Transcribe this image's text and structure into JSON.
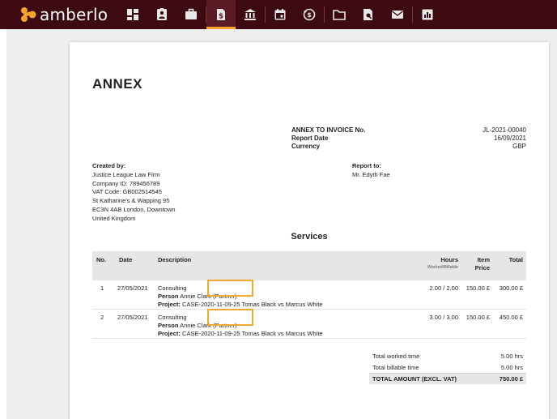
{
  "app": {
    "brand": "amberlo"
  },
  "nav": {
    "items": [
      {
        "name": "dashboard-icon"
      },
      {
        "name": "contacts-icon"
      },
      {
        "name": "briefcase-icon"
      },
      {
        "name": "invoice-icon"
      },
      {
        "name": "bank-icon"
      },
      {
        "name": "calendar-icon"
      },
      {
        "name": "time-money-icon"
      },
      {
        "name": "folder-icon"
      },
      {
        "name": "document-search-icon"
      },
      {
        "name": "mail-icon"
      },
      {
        "name": "reports-icon"
      }
    ],
    "active_index": 3,
    "accent": "#f7a42a",
    "bar_color": "#3d0a12"
  },
  "document": {
    "title": "ANNEX",
    "meta": [
      {
        "label": "ANNEX TO INVOICE No.",
        "value": "JL-2021-00040"
      },
      {
        "label": "Report Date",
        "value": "16/09/2021"
      },
      {
        "label": "Currency",
        "value": "GBP"
      }
    ],
    "created_by": {
      "label": "Created by:",
      "lines": [
        "Justice League Law Firm",
        "Company ID: 789456789",
        "VAT Code: GB002514545",
        "St Katharine's & Wapping 95",
        "EC3N 4AB London, Downtown",
        "United Kingdom"
      ]
    },
    "report_to": {
      "label": "Report to:",
      "name": "Mr. Edyth Fae"
    },
    "services_title": "Services",
    "table": {
      "headers": {
        "no": "No.",
        "date": "Date",
        "description": "Description",
        "hours": "Hours",
        "hours_sub": "Worked/Billable",
        "item_price_1": "Item",
        "item_price_2": "Price",
        "total": "Total"
      },
      "rows": [
        {
          "no": "1",
          "date": "27/05/2021",
          "desc": "Consulting",
          "person_label": "Person",
          "person": "Annie Clark (Partner)",
          "project_label": "Project:",
          "project": "CASE-2020-11-09-25 Tomas Black vs Marcus White",
          "hours": "2.00 /  2.00",
          "price": "150.00 £",
          "total": "300.00 £"
        },
        {
          "no": "2",
          "date": "27/05/2021",
          "desc": "Consulting",
          "person_label": "Person",
          "person": "Annie Clark (Partner)",
          "project_label": "Project:",
          "project": "CASE-2020-11-09-25 Tomas Black vs Marcus White",
          "hours": "3.00 /  3.00",
          "price": "150.00 £",
          "total": "450.00 £"
        }
      ]
    },
    "totals": [
      {
        "label": "Total worked time",
        "value": "5.00 hrs"
      },
      {
        "label": "Total billable time",
        "value": "5.00 hrs"
      },
      {
        "label": "TOTAL AMOUNT (EXCL. VAT)",
        "value": "750.00 £"
      }
    ],
    "highlight_color": "#f0a92e"
  }
}
